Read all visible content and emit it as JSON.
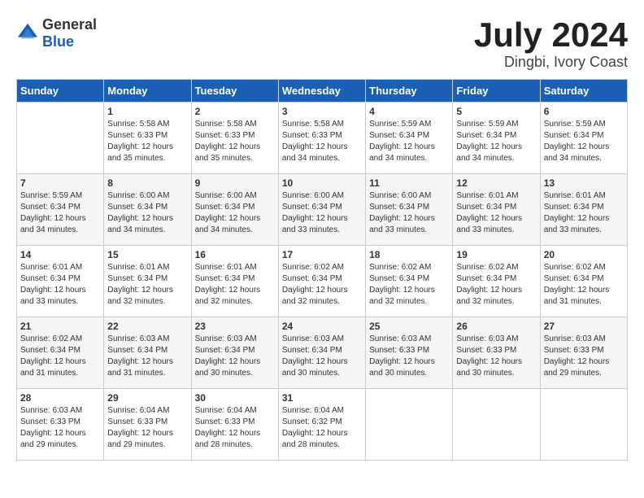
{
  "header": {
    "logo_general": "General",
    "logo_blue": "Blue",
    "month": "July 2024",
    "location": "Dingbi, Ivory Coast"
  },
  "calendar": {
    "weekdays": [
      "Sunday",
      "Monday",
      "Tuesday",
      "Wednesday",
      "Thursday",
      "Friday",
      "Saturday"
    ],
    "rows": [
      [
        {
          "day": "",
          "sunrise": "",
          "sunset": "",
          "daylight": ""
        },
        {
          "day": "1",
          "sunrise": "Sunrise: 5:58 AM",
          "sunset": "Sunset: 6:33 PM",
          "daylight": "Daylight: 12 hours and 35 minutes."
        },
        {
          "day": "2",
          "sunrise": "Sunrise: 5:58 AM",
          "sunset": "Sunset: 6:33 PM",
          "daylight": "Daylight: 12 hours and 35 minutes."
        },
        {
          "day": "3",
          "sunrise": "Sunrise: 5:58 AM",
          "sunset": "Sunset: 6:33 PM",
          "daylight": "Daylight: 12 hours and 34 minutes."
        },
        {
          "day": "4",
          "sunrise": "Sunrise: 5:59 AM",
          "sunset": "Sunset: 6:34 PM",
          "daylight": "Daylight: 12 hours and 34 minutes."
        },
        {
          "day": "5",
          "sunrise": "Sunrise: 5:59 AM",
          "sunset": "Sunset: 6:34 PM",
          "daylight": "Daylight: 12 hours and 34 minutes."
        },
        {
          "day": "6",
          "sunrise": "Sunrise: 5:59 AM",
          "sunset": "Sunset: 6:34 PM",
          "daylight": "Daylight: 12 hours and 34 minutes."
        }
      ],
      [
        {
          "day": "7",
          "sunrise": "Sunrise: 5:59 AM",
          "sunset": "Sunset: 6:34 PM",
          "daylight": "Daylight: 12 hours and 34 minutes."
        },
        {
          "day": "8",
          "sunrise": "Sunrise: 6:00 AM",
          "sunset": "Sunset: 6:34 PM",
          "daylight": "Daylight: 12 hours and 34 minutes."
        },
        {
          "day": "9",
          "sunrise": "Sunrise: 6:00 AM",
          "sunset": "Sunset: 6:34 PM",
          "daylight": "Daylight: 12 hours and 34 minutes."
        },
        {
          "day": "10",
          "sunrise": "Sunrise: 6:00 AM",
          "sunset": "Sunset: 6:34 PM",
          "daylight": "Daylight: 12 hours and 33 minutes."
        },
        {
          "day": "11",
          "sunrise": "Sunrise: 6:00 AM",
          "sunset": "Sunset: 6:34 PM",
          "daylight": "Daylight: 12 hours and 33 minutes."
        },
        {
          "day": "12",
          "sunrise": "Sunrise: 6:01 AM",
          "sunset": "Sunset: 6:34 PM",
          "daylight": "Daylight: 12 hours and 33 minutes."
        },
        {
          "day": "13",
          "sunrise": "Sunrise: 6:01 AM",
          "sunset": "Sunset: 6:34 PM",
          "daylight": "Daylight: 12 hours and 33 minutes."
        }
      ],
      [
        {
          "day": "14",
          "sunrise": "Sunrise: 6:01 AM",
          "sunset": "Sunset: 6:34 PM",
          "daylight": "Daylight: 12 hours and 33 minutes."
        },
        {
          "day": "15",
          "sunrise": "Sunrise: 6:01 AM",
          "sunset": "Sunset: 6:34 PM",
          "daylight": "Daylight: 12 hours and 32 minutes."
        },
        {
          "day": "16",
          "sunrise": "Sunrise: 6:01 AM",
          "sunset": "Sunset: 6:34 PM",
          "daylight": "Daylight: 12 hours and 32 minutes."
        },
        {
          "day": "17",
          "sunrise": "Sunrise: 6:02 AM",
          "sunset": "Sunset: 6:34 PM",
          "daylight": "Daylight: 12 hours and 32 minutes."
        },
        {
          "day": "18",
          "sunrise": "Sunrise: 6:02 AM",
          "sunset": "Sunset: 6:34 PM",
          "daylight": "Daylight: 12 hours and 32 minutes."
        },
        {
          "day": "19",
          "sunrise": "Sunrise: 6:02 AM",
          "sunset": "Sunset: 6:34 PM",
          "daylight": "Daylight: 12 hours and 32 minutes."
        },
        {
          "day": "20",
          "sunrise": "Sunrise: 6:02 AM",
          "sunset": "Sunset: 6:34 PM",
          "daylight": "Daylight: 12 hours and 31 minutes."
        }
      ],
      [
        {
          "day": "21",
          "sunrise": "Sunrise: 6:02 AM",
          "sunset": "Sunset: 6:34 PM",
          "daylight": "Daylight: 12 hours and 31 minutes."
        },
        {
          "day": "22",
          "sunrise": "Sunrise: 6:03 AM",
          "sunset": "Sunset: 6:34 PM",
          "daylight": "Daylight: 12 hours and 31 minutes."
        },
        {
          "day": "23",
          "sunrise": "Sunrise: 6:03 AM",
          "sunset": "Sunset: 6:34 PM",
          "daylight": "Daylight: 12 hours and 30 minutes."
        },
        {
          "day": "24",
          "sunrise": "Sunrise: 6:03 AM",
          "sunset": "Sunset: 6:34 PM",
          "daylight": "Daylight: 12 hours and 30 minutes."
        },
        {
          "day": "25",
          "sunrise": "Sunrise: 6:03 AM",
          "sunset": "Sunset: 6:33 PM",
          "daylight": "Daylight: 12 hours and 30 minutes."
        },
        {
          "day": "26",
          "sunrise": "Sunrise: 6:03 AM",
          "sunset": "Sunset: 6:33 PM",
          "daylight": "Daylight: 12 hours and 30 minutes."
        },
        {
          "day": "27",
          "sunrise": "Sunrise: 6:03 AM",
          "sunset": "Sunset: 6:33 PM",
          "daylight": "Daylight: 12 hours and 29 minutes."
        }
      ],
      [
        {
          "day": "28",
          "sunrise": "Sunrise: 6:03 AM",
          "sunset": "Sunset: 6:33 PM",
          "daylight": "Daylight: 12 hours and 29 minutes."
        },
        {
          "day": "29",
          "sunrise": "Sunrise: 6:04 AM",
          "sunset": "Sunset: 6:33 PM",
          "daylight": "Daylight: 12 hours and 29 minutes."
        },
        {
          "day": "30",
          "sunrise": "Sunrise: 6:04 AM",
          "sunset": "Sunset: 6:33 PM",
          "daylight": "Daylight: 12 hours and 28 minutes."
        },
        {
          "day": "31",
          "sunrise": "Sunrise: 6:04 AM",
          "sunset": "Sunset: 6:32 PM",
          "daylight": "Daylight: 12 hours and 28 minutes."
        },
        {
          "day": "",
          "sunrise": "",
          "sunset": "",
          "daylight": ""
        },
        {
          "day": "",
          "sunrise": "",
          "sunset": "",
          "daylight": ""
        },
        {
          "day": "",
          "sunrise": "",
          "sunset": "",
          "daylight": ""
        }
      ]
    ]
  }
}
